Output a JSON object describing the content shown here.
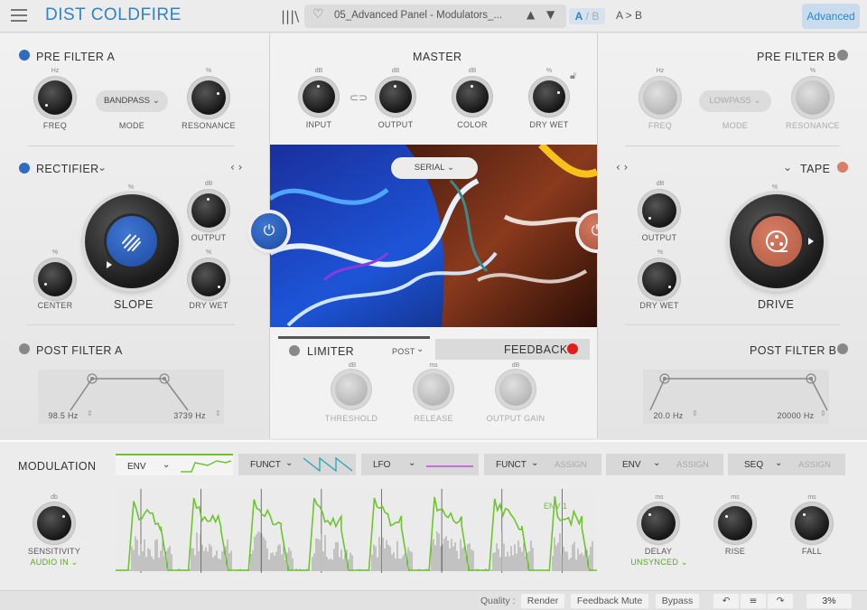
{
  "top": {
    "title": "DIST COLDFIRE",
    "preset_name": "05_Advanced Panel - Modulators_...",
    "ab_a": "A",
    "ab_sep": "/",
    "ab_b": "B",
    "a_to_b": "A > B",
    "advanced": "Advanced"
  },
  "pre_filter_a": {
    "title": "PRE FILTER A",
    "freq_unit": "Hz",
    "freq_label": "FREQ",
    "mode_value": "BANDPASS",
    "mode_label": "MODE",
    "res_unit": "%",
    "res_label": "RESONANCE"
  },
  "rectifier": {
    "title": "RECTIFIER",
    "slope_unit": "%",
    "slope_label": "SLOPE",
    "output_unit": "dB",
    "output_label": "OUTPUT",
    "center_unit": "%",
    "center_label": "CENTER",
    "drywet_unit": "%",
    "drywet_label": "DRY WET"
  },
  "post_filter_a": {
    "title": "POST FILTER A",
    "low": "98.5 Hz",
    "high": "3739 Hz"
  },
  "master": {
    "title": "MASTER",
    "input_unit": "dB",
    "input_label": "INPUT",
    "output_unit": "dB",
    "output_label": "OUTPUT",
    "color_unit": "dB",
    "color_label": "COLOR",
    "drywet_unit": "%",
    "drywet_label": "DRY WET",
    "routing": "SERIAL"
  },
  "limiter": {
    "title": "LIMITER",
    "position": "POST",
    "threshold_unit": "dB",
    "threshold_label": "THRESHOLD",
    "release_unit": "ms",
    "release_label": "RELEASE",
    "gain_unit": "dB",
    "gain_label": "OUTPUT GAIN"
  },
  "feedback": {
    "title": "FEEDBACK"
  },
  "pre_filter_b": {
    "title": "PRE FILTER B",
    "freq_unit": "Hz",
    "freq_label": "FREQ",
    "mode_value": "LOWPASS",
    "mode_label": "MODE",
    "res_unit": "%",
    "res_label": "RESONANCE"
  },
  "tape": {
    "title": "TAPE",
    "drive_unit": "%",
    "drive_label": "DRIVE",
    "output_unit": "dB",
    "output_label": "OUTPUT",
    "drywet_unit": "%",
    "drywet_label": "DRY WET"
  },
  "post_filter_b": {
    "title": "POST FILTER B",
    "low": "20.0 Hz",
    "high": "20000 Hz"
  },
  "modulation": {
    "title": "MODULATION",
    "tabs": [
      {
        "label": "ENV",
        "assign": ""
      },
      {
        "label": "FUNCT",
        "assign": ""
      },
      {
        "label": "LFO",
        "assign": ""
      },
      {
        "label": "FUNCT",
        "assign": "ASSIGN"
      },
      {
        "label": "ENV",
        "assign": "ASSIGN"
      },
      {
        "label": "SEQ",
        "assign": "ASSIGN"
      }
    ],
    "sensitivity_unit": "db",
    "sensitivity_label": "SENSITIVITY",
    "source": "AUDIO IN",
    "env_tag": "ENV 1",
    "delay_unit": "ms",
    "delay_label": "DELAY",
    "delay_sync": "UNSYNCED",
    "rise_unit": "ms",
    "rise_label": "RISE",
    "fall_unit": "ms",
    "fall_label": "FALL"
  },
  "status": {
    "quality_label": "Quality :",
    "render": "Render",
    "feedback_mute": "Feedback Mute",
    "bypass": "Bypass",
    "cpu": "3%"
  },
  "colors": {
    "accent": "#2e84c6",
    "rectifier_blue": "#2f5fb8",
    "tape_orange": "#c9634a",
    "env_green": "#6dc42c",
    "feedback_red": "#e01c1c"
  }
}
